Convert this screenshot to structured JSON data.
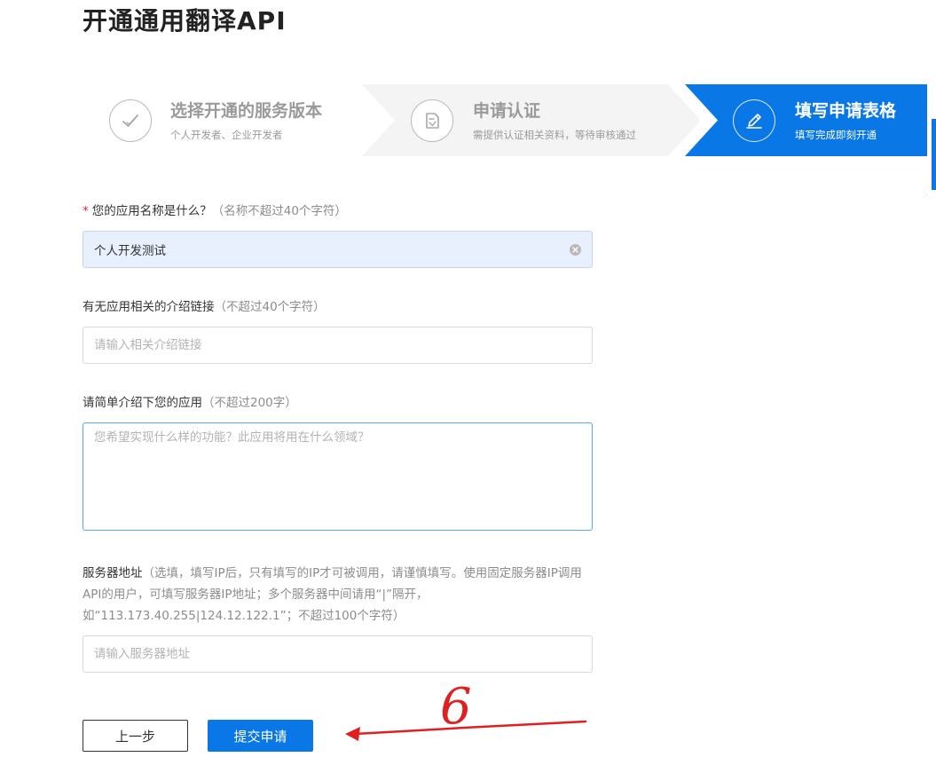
{
  "page": {
    "title": "开通通用翻译API"
  },
  "steps": [
    {
      "title": "选择开通的服务版本",
      "desc": "个人开发者、企业开发者",
      "icon": "check-icon",
      "active": false
    },
    {
      "title": "申请认证",
      "desc": "需提供认证相关资料，等待审核通过",
      "icon": "document-edit-icon",
      "active": false
    },
    {
      "title": "填写申请表格",
      "desc": "填写完成即刻开通",
      "icon": "pencil-icon",
      "active": true
    }
  ],
  "form": {
    "app_name": {
      "required_mark": "*",
      "label": "您的应用名称是什么？",
      "hint": "（名称不超过40个字符）",
      "value": "个人开发测试"
    },
    "intro_link": {
      "label": "有无应用相关的介绍链接",
      "hint": "（不超过40个字符）",
      "placeholder": "请输入相关介绍链接"
    },
    "description": {
      "label": "请简单介绍下您的应用",
      "hint": "（不超过200字）",
      "placeholder": "您希望实现什么样的功能？此应用将用在什么领域？"
    },
    "server_address": {
      "label": "服务器地址",
      "hint": "（选填，填写IP后，只有填写的IP才可被调用，请谨慎填写。使用固定服务器IP调用API的用户，可填写服务器IP地址；多个服务器中间请用“|”隔开，如“113.173.40.255|124.12.122.1”；不超过100个字符）",
      "placeholder": "请输入服务器地址"
    }
  },
  "buttons": {
    "prev": "上一步",
    "submit": "提交申请"
  },
  "annotation": {
    "number": "6",
    "color": "#e02020"
  },
  "colors": {
    "accent": "#0a77e6",
    "step_inactive_bg": "#f4f4f4",
    "filled_input_bg": "#e8f0fe",
    "required": "#f5222d"
  }
}
